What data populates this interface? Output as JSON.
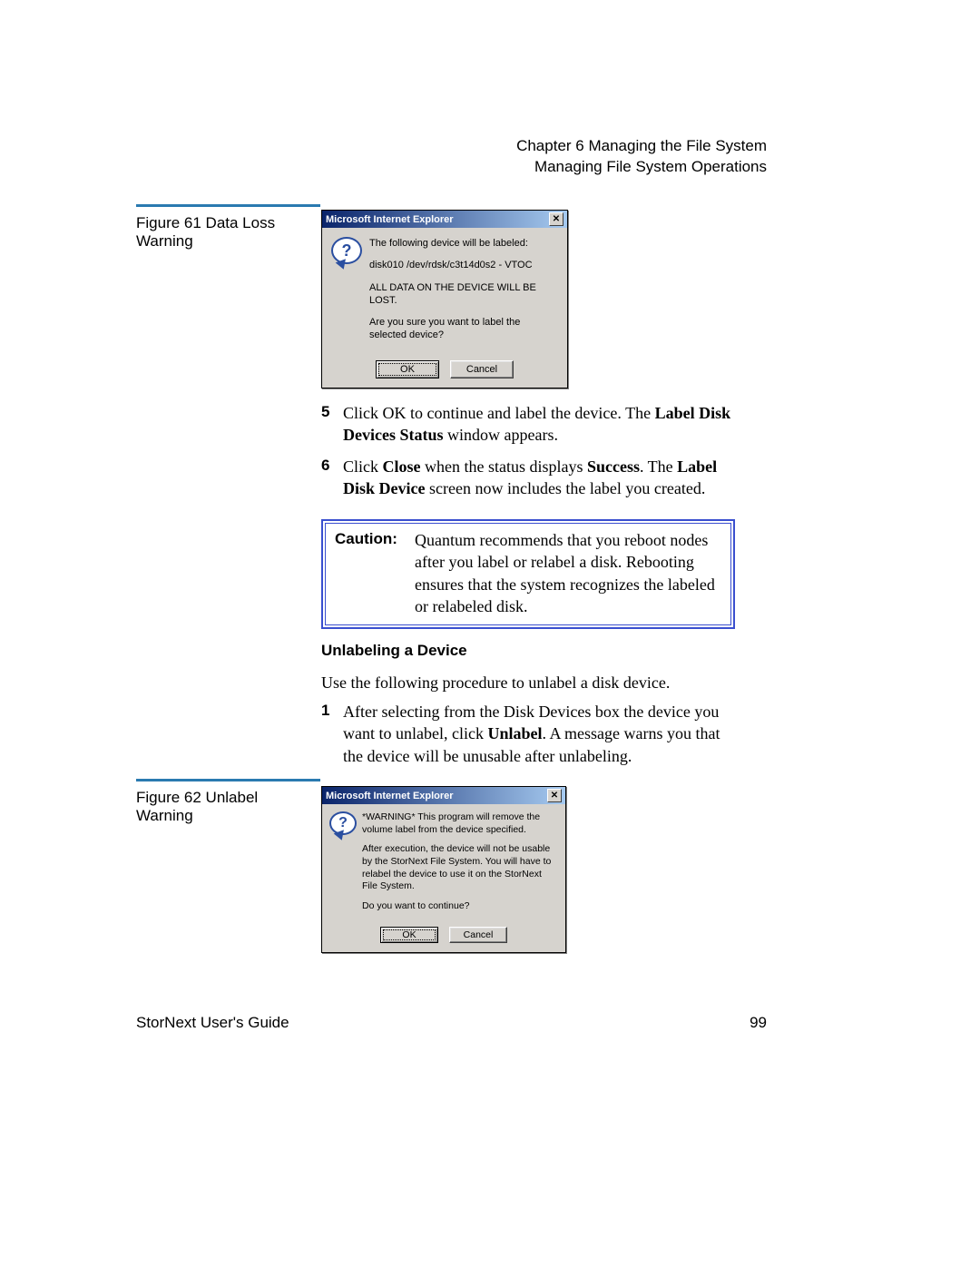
{
  "header": {
    "chapter": "Chapter 6  Managing the File System",
    "section": "Managing File System Operations"
  },
  "fig61": {
    "caption": "Figure 61  Data Loss Warning",
    "dialog": {
      "title": "Microsoft Internet Explorer",
      "line1": "The following device will be labeled:",
      "line2": "disk010 /dev/rdsk/c3t14d0s2 - VTOC",
      "line3": "ALL DATA ON THE DEVICE WILL BE LOST.",
      "line4": "Are you sure you want to label the selected device?",
      "ok": "OK",
      "cancel": "Cancel"
    }
  },
  "step5": {
    "num": "5",
    "pre": "Click OK to continue and label the device. The ",
    "bold": "Label Disk Devices Status",
    "post": " window appears."
  },
  "step6": {
    "num": "6",
    "t1": "Click ",
    "b1": "Close",
    "t2": " when the status displays ",
    "b2": "Success",
    "t3": ". The ",
    "b3": "Label Disk Device",
    "t4": " screen now includes the label you created."
  },
  "caution": {
    "label": "Caution:",
    "text": "Quantum recommends that you reboot nodes after you label or relabel a disk. Rebooting ensures that the system recognizes the labeled or relabeled disk."
  },
  "subhead": "Unlabeling a Device",
  "unlabel_intro": "Use the following procedure to unlabel a disk device.",
  "step1u": {
    "num": "1",
    "t1": "After selecting from the Disk Devices box the device you want to unlabel, click ",
    "b1": "Unlabel",
    "t2": ". A message warns you that the device will be unusable after unlabeling."
  },
  "fig62": {
    "caption": "Figure 62  Unlabel Warning",
    "dialog": {
      "title": "Microsoft Internet Explorer",
      "p1": "*WARNING* This program will remove the volume label from the device specified.",
      "p2": "After execution, the device will not be usable by the StorNext File System. You will have to relabel the device to use it on the StorNext File System.",
      "p3": "Do you want to continue?",
      "ok": "OK",
      "cancel": "Cancel"
    }
  },
  "footer": {
    "left": "StorNext User's Guide",
    "right": "99"
  }
}
